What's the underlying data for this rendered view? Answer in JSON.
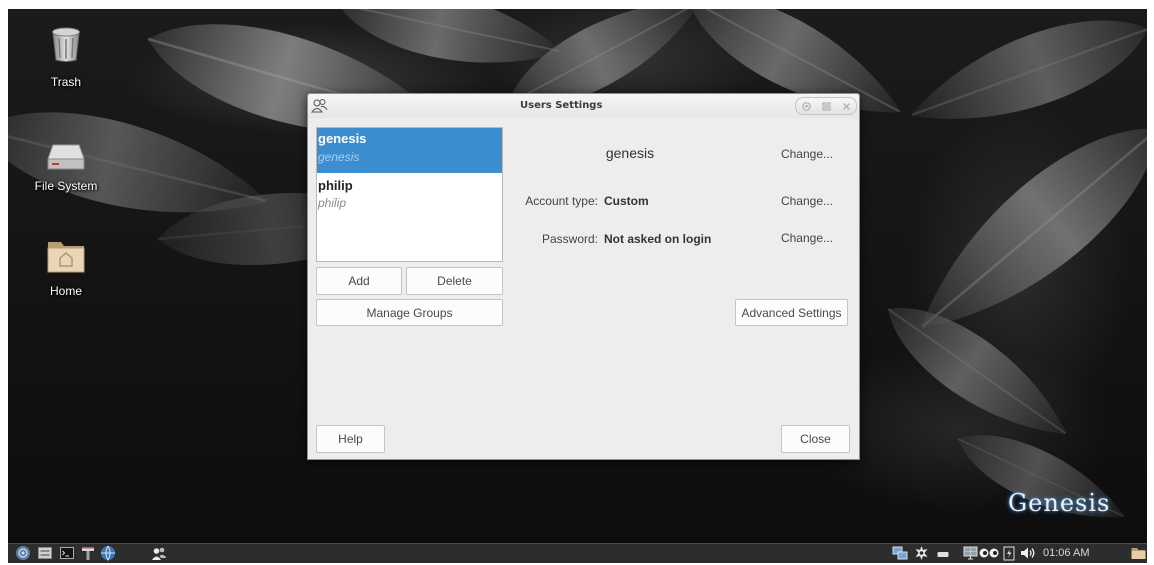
{
  "desktop": {
    "icons": [
      {
        "label": "Trash",
        "icon": "trash-icon"
      },
      {
        "label": "File System",
        "icon": "drive-icon"
      },
      {
        "label": "Home",
        "icon": "home-folder-icon"
      }
    ],
    "logo_text": "Genesis"
  },
  "window": {
    "title": "Users Settings",
    "icon": "users-icon",
    "controls": [
      "minimize-icon",
      "maximize-icon",
      "close-icon"
    ]
  },
  "users": {
    "list": [
      {
        "name": "genesis",
        "login": "genesis",
        "selected": true
      },
      {
        "name": "philip",
        "login": "philip",
        "selected": false
      }
    ],
    "add_label": "Add",
    "delete_label": "Delete",
    "manage_groups_label": "Manage Groups"
  },
  "details": {
    "user_name": "genesis",
    "change_name_label": "Change...",
    "account_type_label": "Account type:",
    "account_type_value": "Custom",
    "change_account_type_label": "Change...",
    "password_label": "Password:",
    "password_value": "Not asked on login",
    "change_password_label": "Change...",
    "advanced_settings_label": "Advanced Settings"
  },
  "footer": {
    "help_label": "Help",
    "close_label": "Close"
  },
  "taskbar": {
    "launchers": [
      "app-menu-icon",
      "file-manager-icon",
      "terminal-icon",
      "tool-icon",
      "web-browser-icon",
      "users-icon"
    ],
    "tray": [
      "network-icon",
      "settings-icon",
      "removable-drive-icon",
      "display-icon",
      "eyes-icon",
      "power-manager-icon",
      "volume-icon",
      "folder-icon"
    ],
    "clock": "01:06 AM"
  },
  "colors": {
    "selection": "#3c8ed1",
    "dialog_bg": "#ededed",
    "taskbar_bg": "#2d2d2d"
  }
}
